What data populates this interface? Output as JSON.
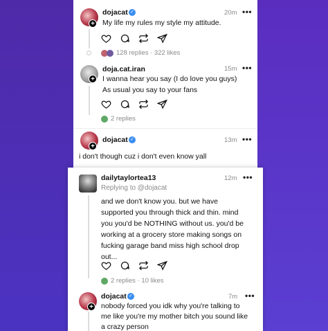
{
  "posts": [
    {
      "username": "dojacat",
      "verified": true,
      "time": "20m",
      "text": "My life my rules my style my attitude.",
      "stats": "128 replies · 322 likes"
    },
    {
      "username": "doja.cat.iran",
      "verified": false,
      "time": "15m",
      "text_lines": [
        "I wanna hear you say (I do love you guys)",
        "As usual you say to your fans"
      ],
      "stats": "2 replies"
    },
    {
      "username": "dojacat",
      "verified": true,
      "time": "13m",
      "text": "i don't though cuz i don't even know yall"
    },
    {
      "username": "dailytaylortea13",
      "verified": false,
      "time": "12m",
      "reply_to": "Replying to @dojacat",
      "text_lines": [
        "and we don't know you. but we have",
        "supported you through thick and thin. mind",
        "you you'd be NOTHING without us. you'd be",
        "working at a grocery store making songs on",
        "fucking garage band miss high school drop",
        "out..."
      ],
      "stats": "2 replies · 10 likes"
    },
    {
      "username": "dojacat",
      "verified": true,
      "time": "7m",
      "text_lines": [
        "nobody forced you idk why you're talking to",
        "me like you're my mother bitch you sound like",
        "a crazy person"
      ]
    }
  ],
  "icons": [
    "heart-icon",
    "comment-icon",
    "repost-icon",
    "share-icon",
    "more-icon",
    "verified-icon",
    "follow-plus-icon"
  ],
  "colors": {
    "verified": "#3b8ef0",
    "background": "#5a35c8",
    "muted": "#8a8a8a"
  },
  "glyphs": {
    "more": "•••",
    "plus": "+",
    "check": "✓"
  }
}
